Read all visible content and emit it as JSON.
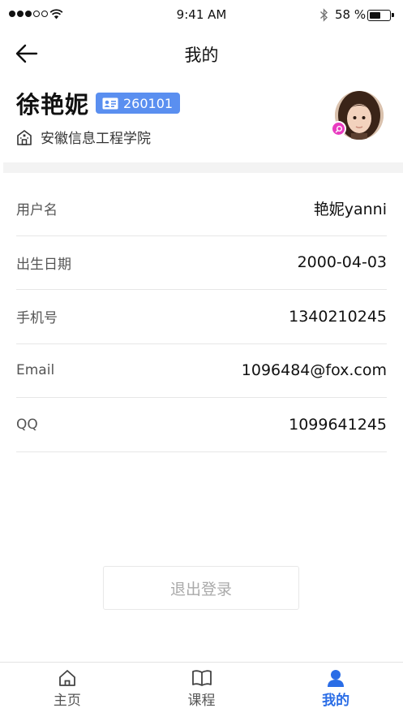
{
  "status_bar": {
    "time": "9:41 AM",
    "battery_percent": "58 %",
    "battery_level": 0.58
  },
  "nav": {
    "title": "我的",
    "back_icon": "arrow-left-icon"
  },
  "profile": {
    "name": "徐艳妮",
    "id_number": "260101",
    "school": "安徽信息工程学院"
  },
  "info": [
    {
      "label": "用户名",
      "value": "艳妮yanni"
    },
    {
      "label": "出生日期",
      "value": "2000-04-03"
    },
    {
      "label": "手机号",
      "value": "1340210245"
    },
    {
      "label": "Email",
      "value": "1096484@fox.com"
    },
    {
      "label": "QQ",
      "value": "1099641245"
    }
  ],
  "logout_label": "退出登录",
  "tabs": [
    {
      "label": "主页",
      "icon": "home-icon"
    },
    {
      "label": "课程",
      "icon": "book-icon"
    },
    {
      "label": "我的",
      "icon": "user-icon",
      "active": true
    }
  ],
  "colors": {
    "accent": "#2a6de6",
    "badge": "#5a8ff0",
    "avatar_badge": "#e83cc0"
  }
}
